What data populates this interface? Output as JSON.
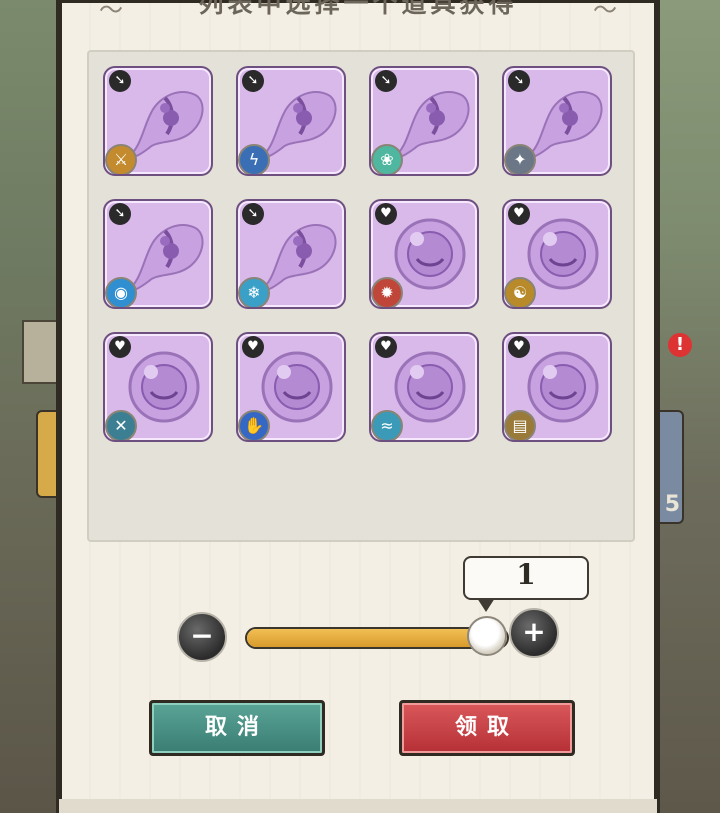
{
  "dialog": {
    "title": "列表中选择一个道具获得",
    "cancel_label": "取消",
    "claim_label": "领取"
  },
  "quantity": {
    "value": "1",
    "slider_fraction": 0.92,
    "minus_label": "−",
    "plus_label": "+"
  },
  "background": {
    "side_count": "5",
    "alert": "!"
  },
  "colors": {
    "item_bg": "#d9b8ea",
    "item_border": "#6d4f80",
    "cancel": "#3a7c72",
    "claim": "#b53036",
    "slider_fill": "#e0a83a"
  },
  "items": [
    {
      "shape": "hairpin",
      "type_icon": "arrow-icon",
      "element_icon": "sword-icon"
    },
    {
      "shape": "hairpin",
      "type_icon": "arrow-icon",
      "element_icon": "lightning-icon"
    },
    {
      "shape": "hairpin",
      "type_icon": "arrow-icon",
      "element_icon": "lotus-icon"
    },
    {
      "shape": "hairpin",
      "type_icon": "arrow-icon",
      "element_icon": "blades-icon"
    },
    {
      "shape": "hairpin",
      "type_icon": "arrow-icon",
      "element_icon": "water-orb-icon"
    },
    {
      "shape": "hairpin",
      "type_icon": "arrow-icon",
      "element_icon": "ice-crystal-icon"
    },
    {
      "shape": "bracelet",
      "type_icon": "heart-icon",
      "element_icon": "fire-icon"
    },
    {
      "shape": "bracelet",
      "type_icon": "heart-icon",
      "element_icon": "yin-yang-icon"
    },
    {
      "shape": "bracelet",
      "type_icon": "heart-icon",
      "element_icon": "cross-blades-icon"
    },
    {
      "shape": "bracelet",
      "type_icon": "heart-icon",
      "element_icon": "palm-icon"
    },
    {
      "shape": "bracelet",
      "type_icon": "heart-icon",
      "element_icon": "wave-icon"
    },
    {
      "shape": "bracelet",
      "type_icon": "heart-icon",
      "element_icon": "tablet-icon"
    }
  ]
}
